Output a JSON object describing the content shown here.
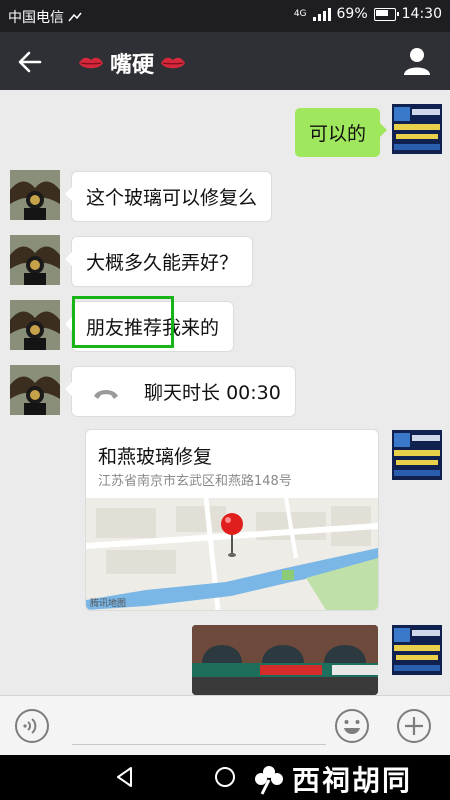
{
  "status_bar": {
    "carrier": "中国电信",
    "network": "4G",
    "battery": "69%",
    "time": "14:30"
  },
  "header": {
    "title": "嘴硬",
    "back_icon": "arrow-left-icon",
    "profile_icon": "person-icon"
  },
  "messages": [
    {
      "side": "right",
      "type": "text",
      "text": "可以的"
    },
    {
      "side": "left",
      "type": "text",
      "text": "这个玻璃可以修复么"
    },
    {
      "side": "left",
      "type": "text",
      "text": "大概多久能弄好？"
    },
    {
      "side": "left",
      "type": "text",
      "text": "朋友推荐我来的"
    },
    {
      "side": "left",
      "type": "call",
      "text": "聊天时长 00:30"
    },
    {
      "side": "right",
      "type": "location",
      "title": "和燕玻璃修复",
      "address": "江苏省南京市玄武区和燕路148号",
      "map_credit": "腾讯地图"
    },
    {
      "side": "right",
      "type": "image"
    }
  ],
  "input": {
    "placeholder": ""
  },
  "watermark": "西祠胡同",
  "colors": {
    "title_bar": "#2f3035",
    "sent_bubble": "#9fe75c",
    "highlight": "#18b418",
    "chat_bg": "#ebebeb"
  }
}
